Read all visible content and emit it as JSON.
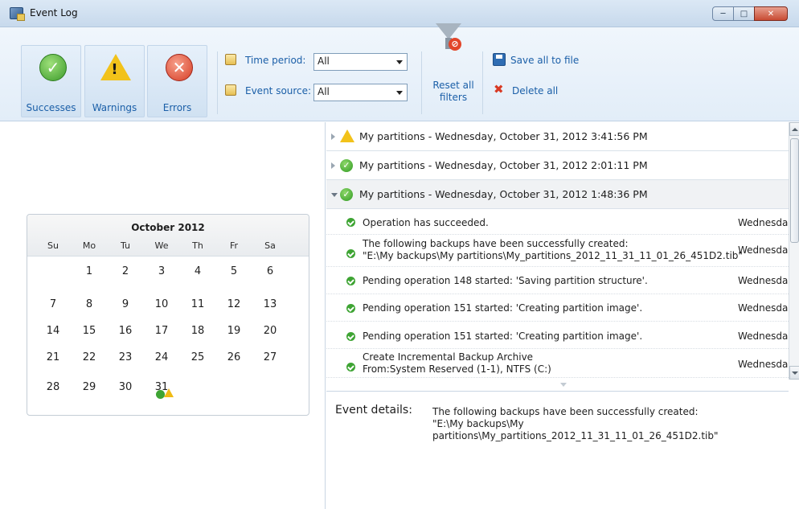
{
  "window": {
    "title": "Event Log",
    "minimize": "─",
    "maximize": "□",
    "close": "✕"
  },
  "toolbar": {
    "filters": [
      {
        "label": "Successes",
        "icon": "success-icon"
      },
      {
        "label": "Warnings",
        "icon": "warning-icon"
      },
      {
        "label": "Errors",
        "icon": "error-icon"
      }
    ],
    "time_period_label": "Time period:",
    "time_period_value": "All",
    "event_source_label": "Event source:",
    "event_source_value": "All",
    "reset_label": "Reset all filters",
    "save_label": "Save all to file",
    "delete_label": "Delete all"
  },
  "calendar": {
    "month": "October 2012",
    "weekdays": [
      "Su",
      "Mo",
      "Tu",
      "We",
      "Th",
      "Fr",
      "Sa"
    ],
    "weeks": [
      [
        "",
        "1",
        "2",
        "3",
        "4",
        "5",
        "6"
      ],
      [
        "7",
        "8",
        "9",
        "10",
        "11",
        "12",
        "13"
      ],
      [
        "14",
        "15",
        "16",
        "17",
        "18",
        "19",
        "20"
      ],
      [
        "21",
        "22",
        "23",
        "24",
        "25",
        "26",
        "27"
      ],
      [
        "28",
        "29",
        "30",
        "31",
        "",
        "",
        ""
      ]
    ],
    "marked_day": "31"
  },
  "events": {
    "groups": [
      {
        "status": "warning",
        "text": "My partitions - Wednesday, October 31, 2012 3:41:56 PM"
      },
      {
        "status": "success",
        "text": "My partitions - Wednesday, October 31, 2012 2:01:11 PM"
      },
      {
        "status": "success",
        "text": "My partitions - Wednesday, October 31, 2012 1:48:36 PM"
      }
    ],
    "entries": [
      {
        "text": "Operation has succeeded.",
        "date": "Wednesda"
      },
      {
        "text": "The following backups have been successfully created:\n\"E:\\My backups\\My partitions\\My_partitions_2012_11_31_11_01_26_451D2.tib\"",
        "date": "Wednesda"
      },
      {
        "text": "Pending operation 148 started: 'Saving partition structure'.",
        "date": "Wednesda"
      },
      {
        "text": "Pending operation 151 started: 'Creating partition image'.",
        "date": "Wednesda"
      },
      {
        "text": "Pending operation 151 started: 'Creating partition image'.",
        "date": "Wednesda"
      },
      {
        "text": "Create Incremental Backup Archive\nFrom:System Reserved (1-1), NTFS (C:)",
        "date": "Wednesda"
      }
    ]
  },
  "details": {
    "label": "Event details:",
    "text": "The following backups have been successfully created:\n\"E:\\My backups\\My\npartitions\\My_partitions_2012_11_31_11_01_26_451D2.tib\""
  }
}
